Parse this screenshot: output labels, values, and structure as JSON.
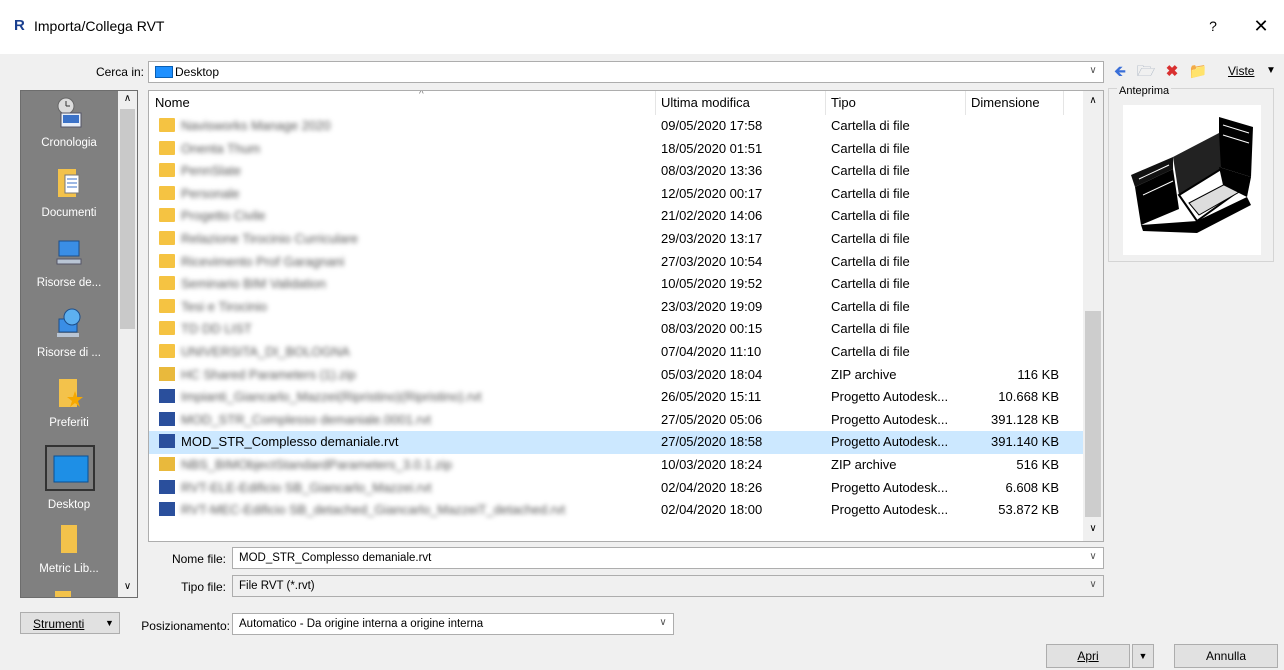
{
  "window": {
    "app_icon": "R",
    "title": "Importa/Collega RVT",
    "help": "?",
    "close": "✕"
  },
  "look_in": {
    "label": "Cerca in:",
    "value": "Desktop"
  },
  "toolbar": {
    "views_label": "Viste"
  },
  "sidebar": {
    "items": [
      {
        "label": "Cronologia",
        "icon": "history-icon"
      },
      {
        "label": "Documenti",
        "icon": "documents-icon"
      },
      {
        "label": "Risorse de...",
        "icon": "computer-icon"
      },
      {
        "label": "Risorse di ...",
        "icon": "network-icon"
      },
      {
        "label": "Preferiti",
        "icon": "favorites-icon"
      },
      {
        "label": "Desktop",
        "icon": "desktop-icon"
      },
      {
        "label": "Metric Lib...",
        "icon": "folder-icon"
      }
    ]
  },
  "file_list": {
    "columns": [
      "Nome",
      "Ultima modifica",
      "Tipo",
      "Dimensione"
    ],
    "rows": [
      {
        "name": "Navisworks Manage 2020",
        "date": "09/05/2020 17:58",
        "type": "Cartella di file",
        "size": "",
        "kind": "folder",
        "blurred": true
      },
      {
        "name": "Onenta Thum",
        "date": "18/05/2020 01:51",
        "type": "Cartella di file",
        "size": "",
        "kind": "folder",
        "blurred": true
      },
      {
        "name": "PennSlate",
        "date": "08/03/2020 13:36",
        "type": "Cartella di file",
        "size": "",
        "kind": "folder",
        "blurred": true
      },
      {
        "name": "Personale",
        "date": "12/05/2020 00:17",
        "type": "Cartella di file",
        "size": "",
        "kind": "folder",
        "blurred": true
      },
      {
        "name": "Progetto Civile",
        "date": "21/02/2020 14:06",
        "type": "Cartella di file",
        "size": "",
        "kind": "folder",
        "blurred": true
      },
      {
        "name": "Relazione Tirocinio Curriculare",
        "date": "29/03/2020 13:17",
        "type": "Cartella di file",
        "size": "",
        "kind": "folder",
        "blurred": true
      },
      {
        "name": "Ricevimento Prof Garagnani",
        "date": "27/03/2020 10:54",
        "type": "Cartella di file",
        "size": "",
        "kind": "folder",
        "blurred": true
      },
      {
        "name": "Seminario BIM Validation",
        "date": "10/05/2020 19:52",
        "type": "Cartella di file",
        "size": "",
        "kind": "folder",
        "blurred": true
      },
      {
        "name": "Tesi e Tirocinio",
        "date": "23/03/2020 19:09",
        "type": "Cartella di file",
        "size": "",
        "kind": "folder",
        "blurred": true
      },
      {
        "name": "TD DD LIST",
        "date": "08/03/2020 00:15",
        "type": "Cartella di file",
        "size": "",
        "kind": "folder",
        "blurred": true
      },
      {
        "name": "UNIVERSITA_DI_BOLOGNA",
        "date": "07/04/2020 11:10",
        "type": "Cartella di file",
        "size": "",
        "kind": "folder",
        "blurred": true
      },
      {
        "name": "HC Shared Parameters (1).zip",
        "date": "05/03/2020 18:04",
        "type": "ZIP archive",
        "size": "116 KB",
        "kind": "zip",
        "blurred": true
      },
      {
        "name": "Impianti_Giancarlo_Mazzei(Ripristino)(Ripristino).rvt",
        "date": "26/05/2020 15:11",
        "type": "Progetto Autodesk...",
        "size": "10.668 KB",
        "kind": "rvt",
        "blurred": true
      },
      {
        "name": "MOD_STR_Complesso demaniale.0001.rvt",
        "date": "27/05/2020 05:06",
        "type": "Progetto Autodesk...",
        "size": "391.128 KB",
        "kind": "rvt",
        "blurred": true
      },
      {
        "name": "MOD_STR_Complesso demaniale.rvt",
        "date": "27/05/2020 18:58",
        "type": "Progetto Autodesk...",
        "size": "391.140 KB",
        "kind": "rvt",
        "blurred": false,
        "selected": true
      },
      {
        "name": "NBS_BIMObjectStandardParameters_3.0.1.zip",
        "date": "10/03/2020 18:24",
        "type": "ZIP archive",
        "size": "516 KB",
        "kind": "zip",
        "blurred": true
      },
      {
        "name": "RVT-ELE-Edificio SB_Giancarlo_Mazzei.rvt",
        "date": "02/04/2020 18:26",
        "type": "Progetto Autodesk...",
        "size": "6.608 KB",
        "kind": "rvt",
        "blurred": true
      },
      {
        "name": "RVT-MEC-Edificio SB_detached_Giancarlo_MazzeiT_detached.rvt",
        "date": "02/04/2020 18:00",
        "type": "Progetto Autodesk...",
        "size": "53.872 KB",
        "kind": "rvt",
        "blurred": true
      }
    ]
  },
  "preview": {
    "label": "Anteprima"
  },
  "filename": {
    "label": "Nome file:",
    "value": "MOD_STR_Complesso demaniale.rvt"
  },
  "filetype": {
    "label": "Tipo file:",
    "value": "File RVT  (*.rvt)"
  },
  "tools": {
    "label": "Strumenti"
  },
  "positioning": {
    "label": "Posizionamento:",
    "value": "Automatico - Da origine interna a origine interna"
  },
  "buttons": {
    "open": "Apri",
    "cancel": "Annulla"
  },
  "colors": {
    "selection": "#cce8ff",
    "sidebar": "#808080",
    "folder": "#f5c342",
    "rvt": "#2a4f9c"
  }
}
